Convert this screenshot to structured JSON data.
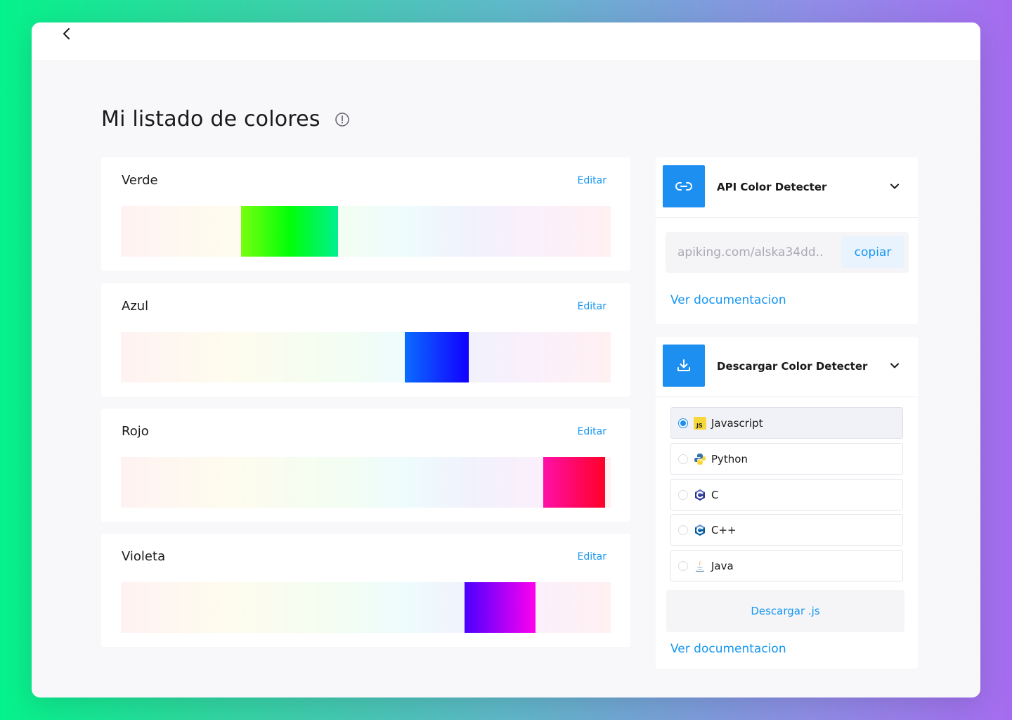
{
  "page": {
    "title": "Mi listado de colores"
  },
  "colors": [
    {
      "name": "Verde",
      "edit_label": "Editar",
      "gradient": [
        "#78ff10",
        "#00ff08",
        "#00f090"
      ],
      "position": 0.245,
      "width": 0.198
    },
    {
      "name": "Azul",
      "edit_label": "Editar",
      "gradient": [
        "#0a6cff",
        "#1200ff"
      ],
      "position": 0.579,
      "width": 0.131
    },
    {
      "name": "Rojo",
      "edit_label": "Editar",
      "gradient": [
        "#ff10a8",
        "#ff0028"
      ],
      "position": 0.862,
      "width": 0.126
    },
    {
      "name": "Violeta",
      "edit_label": "Editar",
      "gradient": [
        "#4a00ff",
        "#ff00ee"
      ],
      "position": 0.701,
      "width": 0.145
    }
  ],
  "api_panel": {
    "title": "API Color Detecter",
    "url": "apiking.com/alska34dd..",
    "copy_label": "copiar",
    "doc_link": "Ver documentacion"
  },
  "download_panel": {
    "title": "Descargar Color Detecter",
    "languages": [
      {
        "label": "Javascript",
        "icon": "javascript-icon",
        "selected": true
      },
      {
        "label": "Python",
        "icon": "python-icon",
        "selected": false
      },
      {
        "label": "C",
        "icon": "c-icon",
        "selected": false
      },
      {
        "label": "C++",
        "icon": "cpp-icon",
        "selected": false
      },
      {
        "label": "Java",
        "icon": "java-icon",
        "selected": false
      }
    ],
    "download_label": "Descargar .js",
    "doc_link": "Ver documentacion"
  },
  "theme": {
    "accent": "#1c8ff0",
    "link": "#1596f2"
  }
}
